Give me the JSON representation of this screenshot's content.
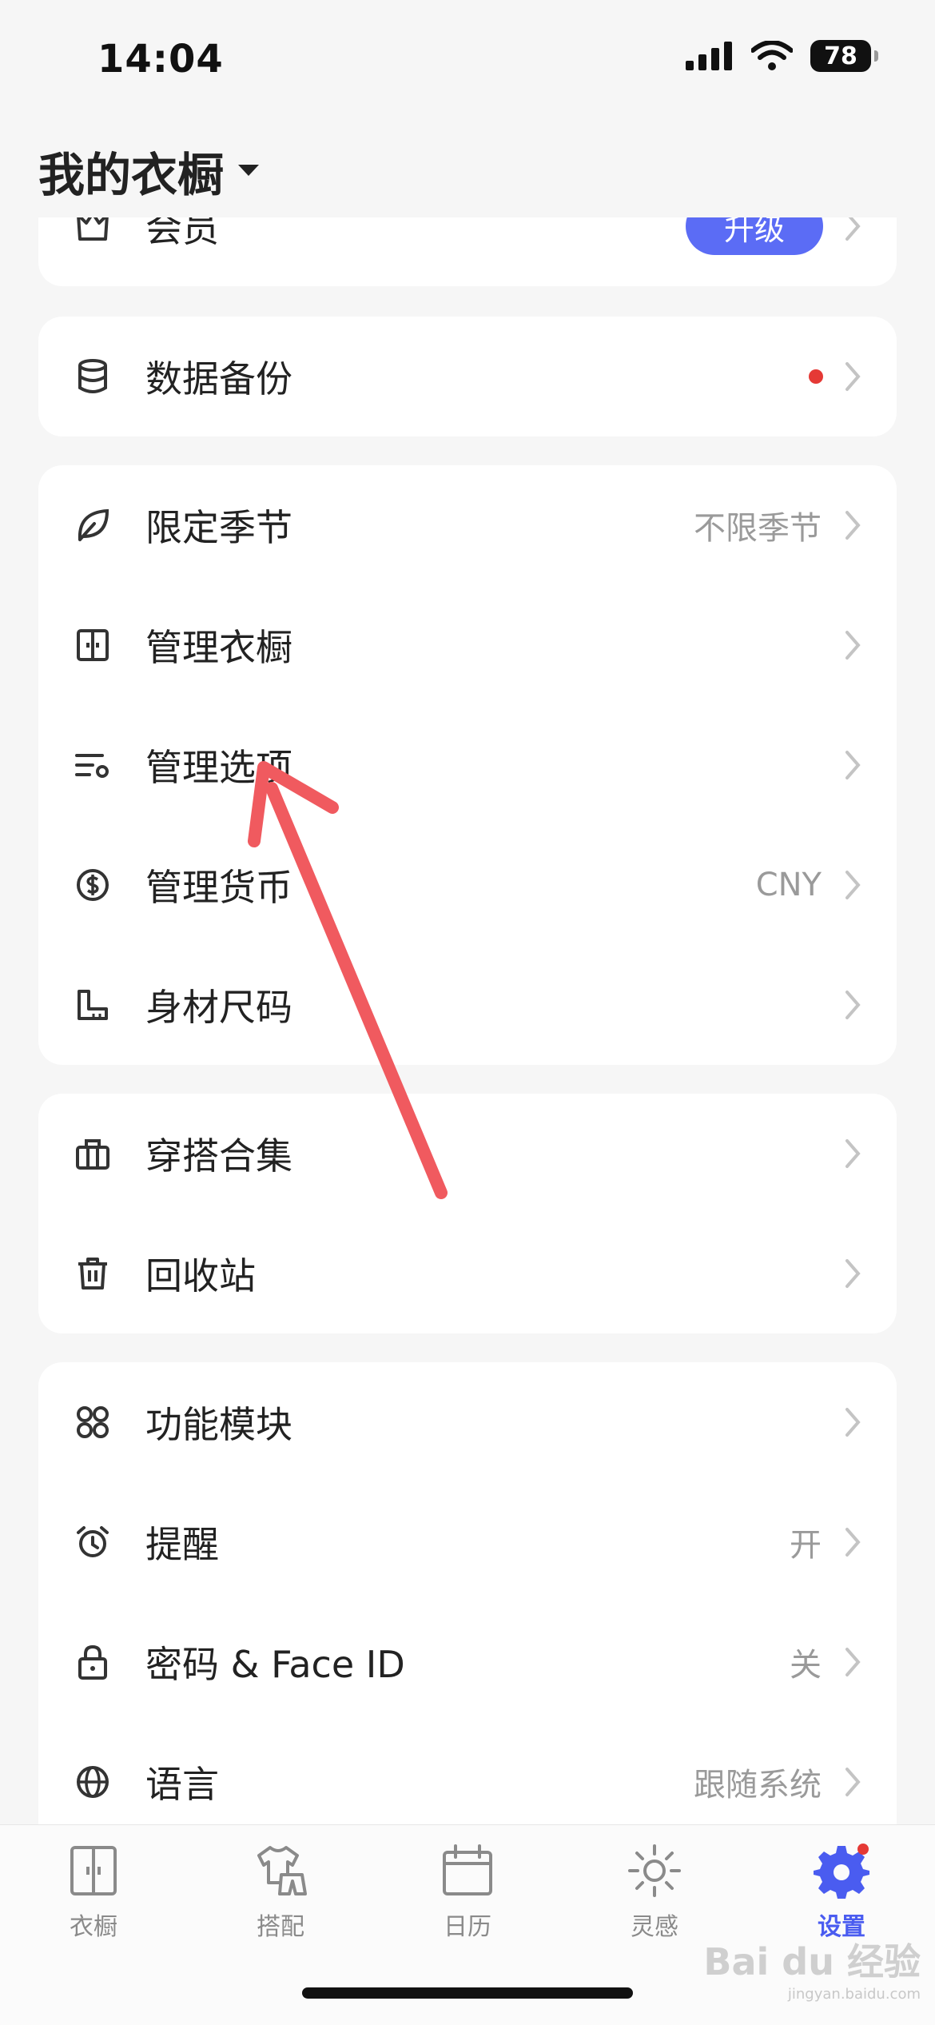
{
  "status_bar": {
    "time": "14:04",
    "battery": "78"
  },
  "header": {
    "title": "我的衣橱"
  },
  "groups": [
    {
      "rows": [
        {
          "label": "会员",
          "icon": "crown-icon",
          "button": "升级"
        }
      ]
    },
    {
      "rows": [
        {
          "label": "数据备份",
          "icon": "database-icon",
          "badge": "red-dot"
        }
      ]
    },
    {
      "rows": [
        {
          "label": "限定季节",
          "icon": "leaf-icon",
          "value": "不限季节"
        },
        {
          "label": "管理衣橱",
          "icon": "wardrobe-icon"
        },
        {
          "label": "管理选项",
          "icon": "options-settings-icon"
        },
        {
          "label": "管理货币",
          "icon": "currency-icon",
          "value": "CNY"
        },
        {
          "label": "身材尺码",
          "icon": "ruler-icon"
        }
      ]
    },
    {
      "rows": [
        {
          "label": "穿搭合集",
          "icon": "collection-icon"
        },
        {
          "label": "回收站",
          "icon": "trash-icon"
        }
      ]
    },
    {
      "rows": [
        {
          "label": "功能模块",
          "icon": "modules-icon"
        },
        {
          "label": "提醒",
          "icon": "alarm-icon",
          "value": "开"
        },
        {
          "label": "密码 & Face ID",
          "icon": "lock-icon",
          "value": "关"
        },
        {
          "label": "语言",
          "icon": "globe-icon",
          "value": "跟随系统"
        }
      ]
    }
  ],
  "tabs": [
    {
      "label": "衣橱",
      "icon": "wardrobe-icon",
      "active": false
    },
    {
      "label": "搭配",
      "icon": "outfit-icon",
      "active": false
    },
    {
      "label": "日历",
      "icon": "calendar-icon",
      "active": false
    },
    {
      "label": "灵感",
      "icon": "sun-icon",
      "active": false
    },
    {
      "label": "设置",
      "icon": "gear-icon",
      "active": true
    }
  ],
  "watermark": {
    "text": "Bai du 经验",
    "sub": "jingyan.baidu.com"
  },
  "colors": {
    "accent": "#4a5cf0",
    "upgrade_button": "#5b6cf5",
    "badge": "#e53935",
    "annotation_arrow": "#f05a5f"
  }
}
